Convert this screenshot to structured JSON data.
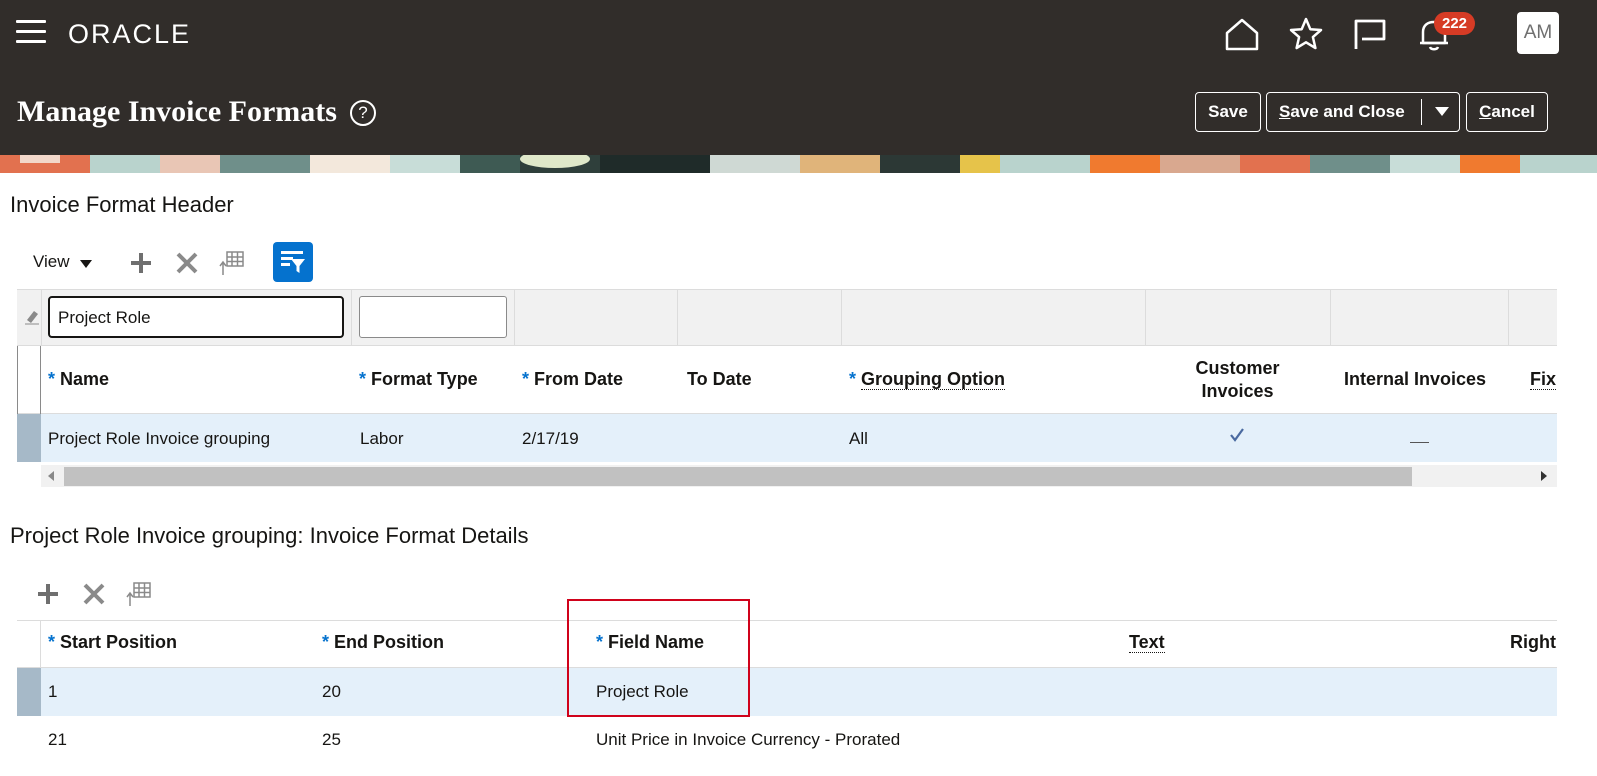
{
  "header": {
    "logo": "ORACLE",
    "notification_count": "222",
    "avatar_initials": "AM",
    "page_title": "Manage Invoice Formats",
    "help_glyph": "?",
    "buttons": {
      "save": "Save",
      "save_and_close_u": "S",
      "save_and_close_rest": "ave and Close",
      "cancel_u": "C",
      "cancel_rest": "ancel"
    }
  },
  "icons": {
    "menu": "hamburger-menu-icon",
    "home": "home-icon",
    "favorites": "star-icon",
    "flag": "flag-icon",
    "notifications": "bell-icon",
    "help": "help-icon",
    "add": "plus-icon",
    "delete": "x-icon",
    "freeze": "freeze-columns-icon",
    "filter": "query-by-example-icon",
    "check": "check-icon"
  },
  "colors": {
    "header_bg": "#312d2a",
    "accent": "#0572ce",
    "selected_row": "#e4f0fa",
    "highlight": "#d0021b"
  },
  "format_header": {
    "title": "Invoice Format Header",
    "view_label": "View",
    "filters": {
      "name": "Project Role",
      "format_type": ""
    },
    "columns": [
      {
        "label": "Name",
        "required": true
      },
      {
        "label": "Format Type",
        "required": true
      },
      {
        "label": "From Date",
        "required": true
      },
      {
        "label": "To Date",
        "required": false
      },
      {
        "label": "Grouping Option",
        "required": true
      },
      {
        "label": "Customer Invoices",
        "line1": "Customer",
        "line2": "Invoices",
        "required": false
      },
      {
        "label": "Internal Invoices",
        "required": false
      },
      {
        "label": "Fix",
        "required": false
      }
    ],
    "rows": [
      {
        "name": "Project Role Invoice grouping",
        "format_type": "Labor",
        "from_date": "2/17/19",
        "to_date": "",
        "grouping_option": "All",
        "customer_invoices": true,
        "internal_invoices": false
      }
    ]
  },
  "format_details": {
    "title": "Project Role Invoice grouping: Invoice Format Details",
    "columns": [
      {
        "label": "Start Position",
        "required": true
      },
      {
        "label": "End Position",
        "required": true
      },
      {
        "label": "Field Name",
        "required": true
      },
      {
        "label": "Text",
        "required": false
      },
      {
        "label": "Right",
        "required": false
      }
    ],
    "rows": [
      {
        "start": "1",
        "end": "20",
        "field_name": "Project Role"
      },
      {
        "start": "21",
        "end": "25",
        "field_name": "Unit Price in Invoice Currency - Prorated"
      }
    ]
  }
}
